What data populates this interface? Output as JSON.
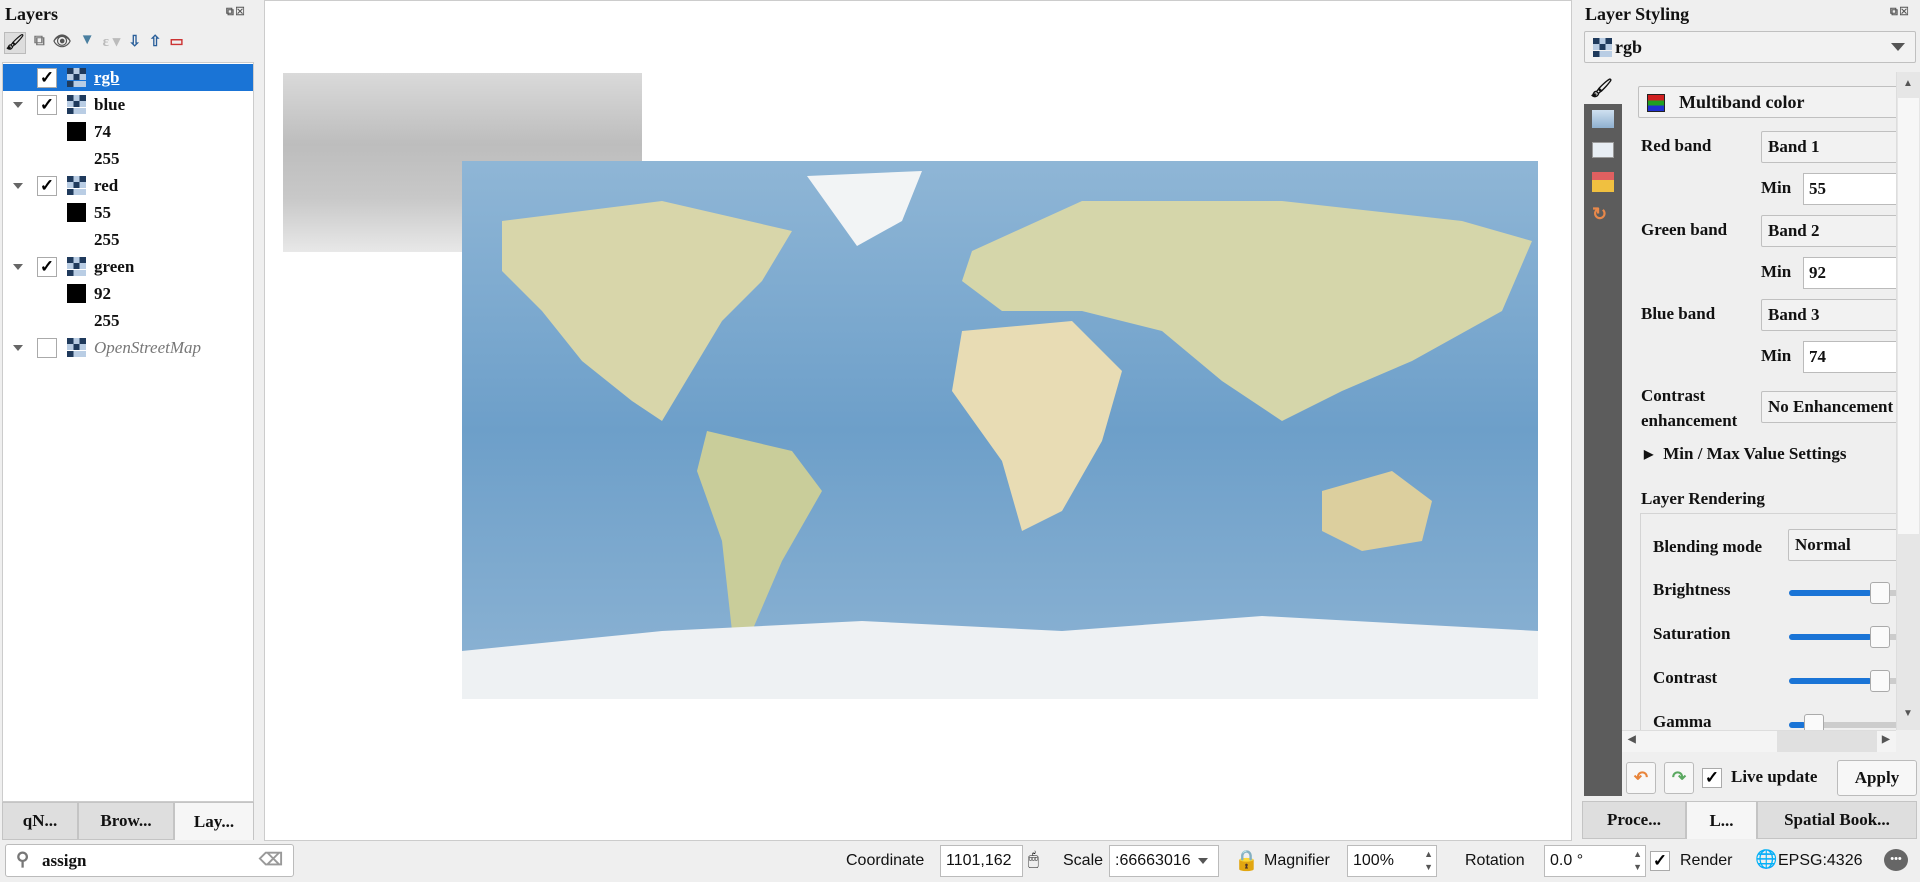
{
  "layers_panel": {
    "title": "Layers",
    "toolbar_icons": [
      "style-manager-icon",
      "add-group-icon",
      "visibility-icon",
      "filter-icon",
      "filter-expression-icon",
      "expand-all-icon",
      "collapse-all-icon",
      "remove-layer-icon"
    ],
    "items": [
      {
        "label": "rgb",
        "checked": true,
        "selected": true
      },
      {
        "label": "blue",
        "checked": true,
        "legend": [
          "74",
          "255"
        ]
      },
      {
        "label": "red",
        "checked": true,
        "legend": [
          "55",
          "255"
        ]
      },
      {
        "label": "green",
        "checked": true,
        "legend": [
          "92",
          "255"
        ]
      },
      {
        "label": "OpenStreetMap",
        "checked": false
      }
    ],
    "tabs": [
      "qN...",
      "Brow...",
      "Lay..."
    ],
    "active_tab": "Lay..."
  },
  "search": {
    "value": "assign"
  },
  "styling_panel": {
    "title": "Layer Styling",
    "layer": "rgb",
    "renderer": "Multiband color",
    "red_band_label": "Red band",
    "red_band": "Band 1",
    "red_min": "55",
    "green_band_label": "Green band",
    "green_band": "Band 2",
    "green_min": "92",
    "blue_band_label": "Blue band",
    "blue_band": "Band 3",
    "blue_min": "74",
    "min_label": "Min",
    "contrast_label_1": "Contrast",
    "contrast_label_2": "enhancement",
    "contrast": "No Enhancement",
    "minmax_label": "Min / Max Value Settings",
    "rendering_title": "Layer Rendering",
    "blending_label": "Blending mode",
    "blending": "Normal",
    "sliders": [
      {
        "label": "Brightness",
        "value": 0.5
      },
      {
        "label": "Saturation",
        "value": 0.5
      },
      {
        "label": "Contrast",
        "value": 0.5
      },
      {
        "label": "Gamma",
        "value": 0.1
      }
    ],
    "live_update_label": "Live update",
    "live_update": true,
    "apply_label": "Apply",
    "tabs": [
      "Proce...",
      "L...",
      "Spatial Book..."
    ],
    "active_tab": "L..."
  },
  "status_bar": {
    "coordinate_label": "Coordinate",
    "coordinate": "1101,162",
    "scale_label": "Scale",
    "scale": ":66663016",
    "magnifier_label": "Magnifier",
    "magnifier": "100%",
    "rotation_label": "Rotation",
    "rotation": "0.0 °",
    "render_label": "Render",
    "render": true,
    "crs": "EPSG:4326"
  },
  "colors": {
    "accent": "#1a74d6",
    "ocean": "#6d9fc9",
    "land": "#d9d3a8",
    "strip": "#5c5c5c"
  }
}
